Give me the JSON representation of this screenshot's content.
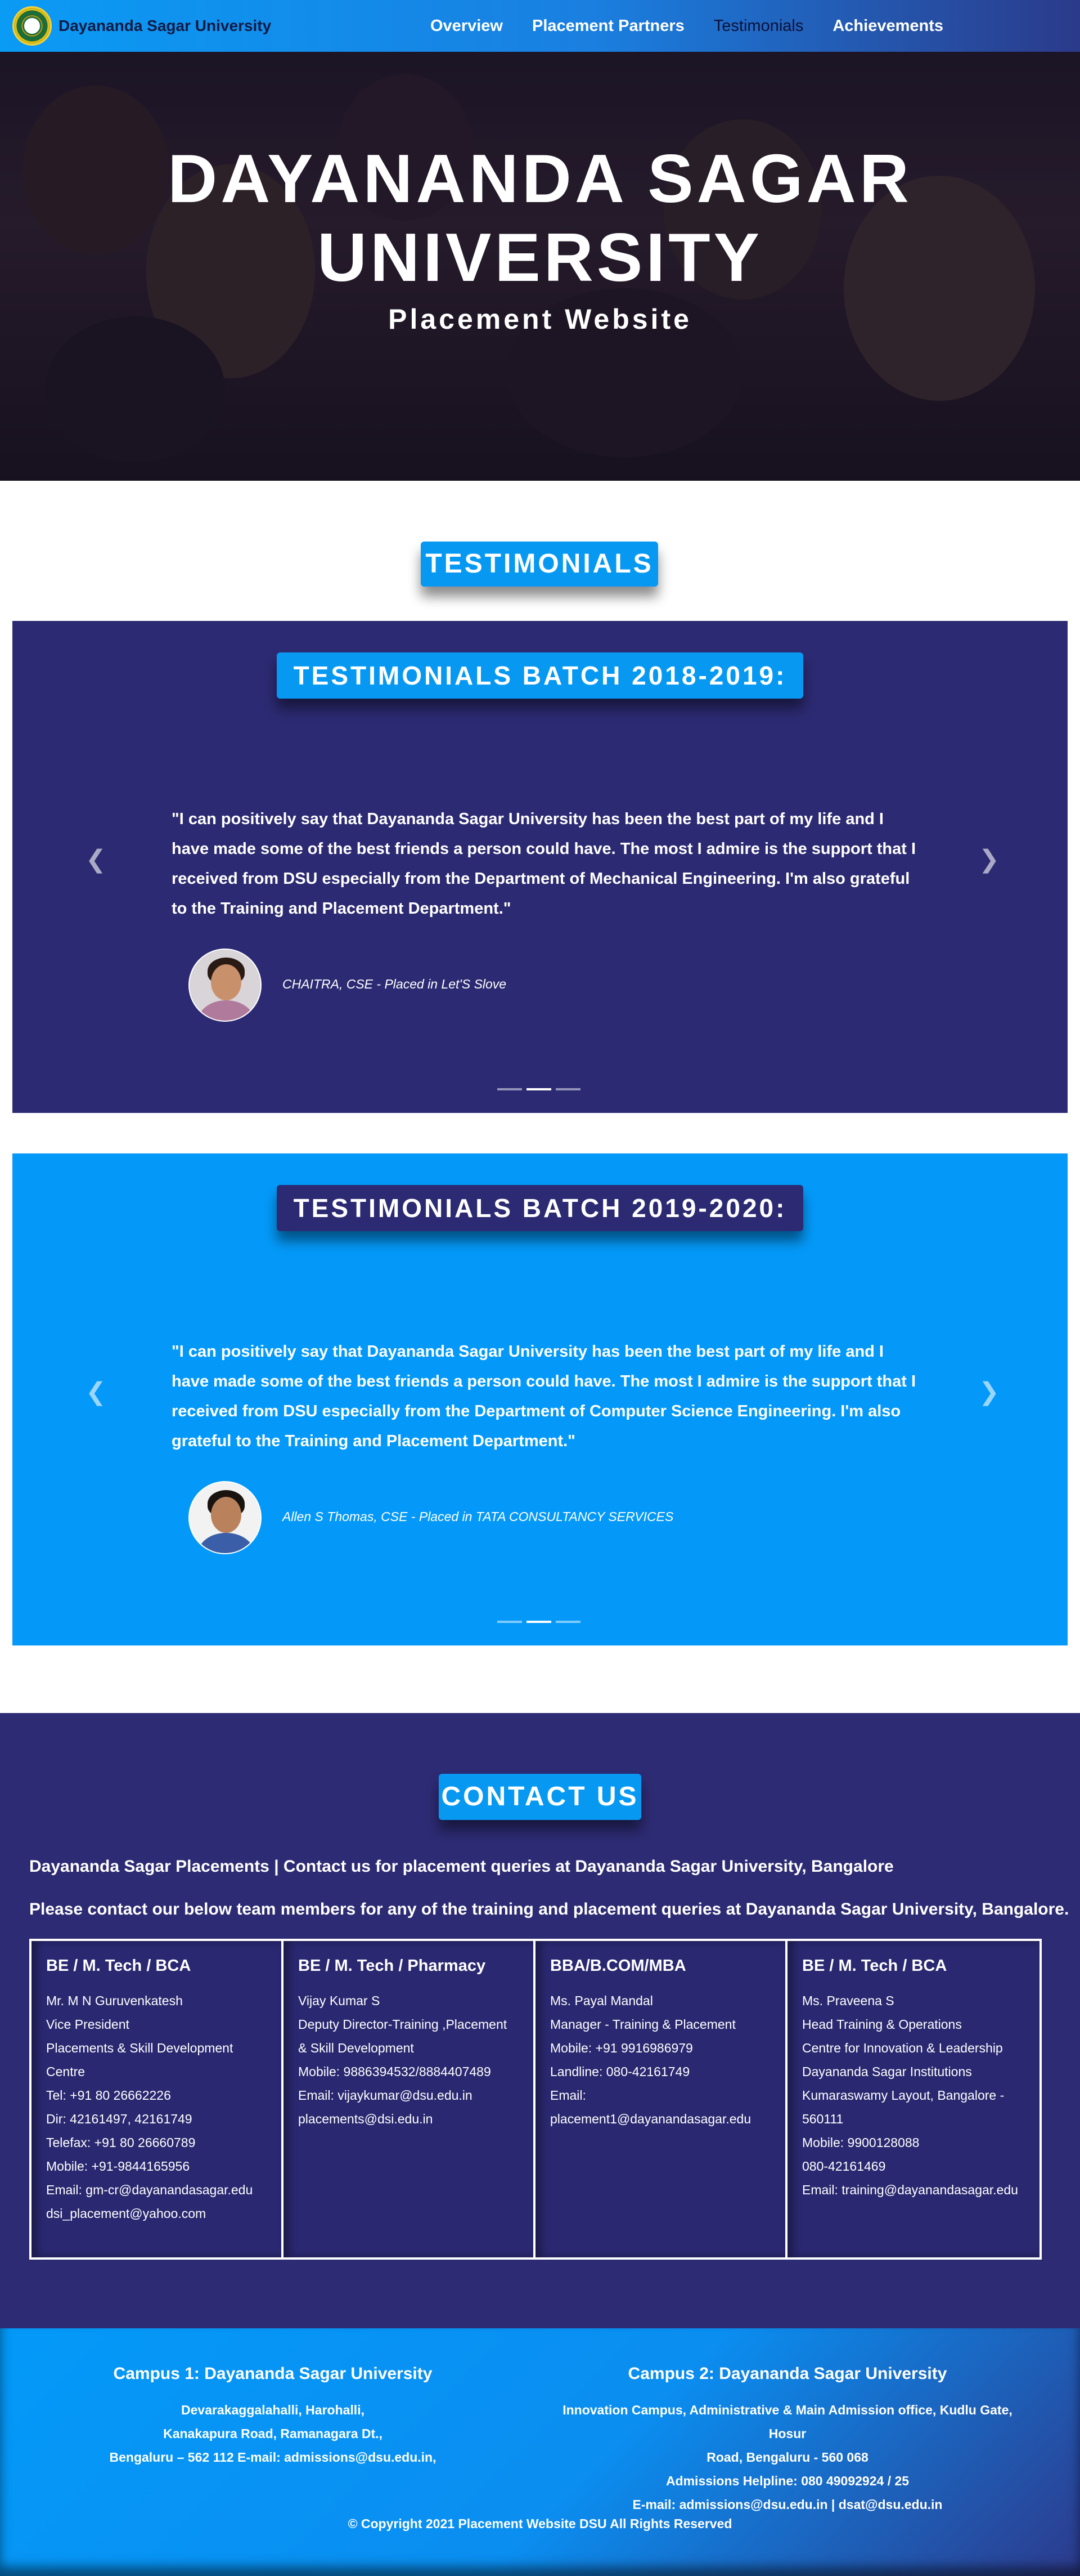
{
  "nav": {
    "brand": "Dayananda Sagar University",
    "links": [
      "Overview",
      "Placement Partners",
      "Testimonials",
      "Achievements"
    ]
  },
  "hero": {
    "title_line1": "DAYANANDA SAGAR",
    "title_line2": "UNIVERSITY",
    "subtitle": "Placement Website"
  },
  "testimonials": {
    "heading": "TESTIMONIALS",
    "batches": [
      {
        "heading": "TESTIMONIALS BATCH 2018-2019:",
        "quote": "\"I can positively say that Dayananda Sagar University has been the best part of my life and I have made some of the best friends a person could have. The most I admire is the support that I received from DSU especially from the Department of Mechanical Engineering. I'm also grateful to the Training and Placement Department.\"",
        "caption": "CHAITRA, CSE - Placed in Let'S Slove"
      },
      {
        "heading": "TESTIMONIALS BATCH 2019-2020:",
        "quote": "\"I can positively say that Dayananda Sagar University has been the best part of my life and I have made some of the best friends a person could have. The most I admire is the support that I received from DSU especially from the Department of Computer Science Engineering. I'm also grateful to the Training and Placement Department.\"",
        "caption": "Allen S Thomas, CSE - Placed in TATA CONSULTANCY SERVICES"
      }
    ],
    "prev_icon": "chevron-left-icon",
    "next_icon": "chevron-right-icon"
  },
  "contact": {
    "heading": "CONTACT US",
    "line1": "Dayananda Sagar Placements | Contact us for placement queries at Dayananda Sagar University, Bangalore",
    "line2": "Please contact our below team members for any of the training and placement queries at Dayananda Sagar University, Bangalore.",
    "cards": [
      {
        "title": "BE / M. Tech / BCA",
        "lines": [
          "Mr. M N Guruvenkatesh",
          "Vice President",
          "Placements & Skill Development",
          "Centre",
          "Tel: +91 80 26662226",
          "Dir: 42161497, 42161749",
          "Telefax: +91 80 26660789",
          "Mobile: +91-9844165956",
          "Email: gm-cr@dayanandasagar.edu",
          "dsi_placement@yahoo.com"
        ]
      },
      {
        "title": "BE / M. Tech / Pharmacy",
        "lines": [
          "Vijay Kumar S",
          "Deputy Director-Training ,Placement",
          "& Skill Development",
          "Mobile: 9886394532/8884407489",
          "Email: vijaykumar@dsu.edu.in",
          "placements@dsi.edu.in"
        ]
      },
      {
        "title": "BBA/B.COM/MBA",
        "lines": [
          "Ms. Payal Mandal",
          "Manager - Training & Placement",
          "Mobile: +91 9916986979",
          "Landline: 080-42161749",
          "Email:",
          "placement1@dayanandasagar.edu"
        ]
      },
      {
        "title": "BE / M. Tech / BCA",
        "lines": [
          "Ms. Praveena S",
          "Head Training & Operations",
          "Centre for Innovation & Leadership",
          "Dayananda Sagar Institutions",
          "Kumaraswamy Layout, Bangalore -",
          "560111",
          "Mobile: 9900128088",
          "080-42161469",
          "Email: training@dayanandasagar.edu"
        ]
      }
    ]
  },
  "footer": {
    "campus1": {
      "title": "Campus 1: Dayananda Sagar University",
      "lines": [
        "Devarakaggalahalli, Harohalli,",
        "Kanakapura Road, Ramanagara Dt.,",
        "Bengaluru – 562 112 E-mail: admissions@dsu.edu.in,"
      ]
    },
    "campus2": {
      "title": "Campus 2: Dayananda Sagar University",
      "lines": [
        "Innovation Campus, Administrative & Main Admission office, Kudlu Gate, Hosur",
        "Road, Bengaluru - 560 068",
        "Admissions Helpline: 080 49092924 / 25",
        "E-mail: admissions@dsu.edu.in | dsat@dsu.edu.in"
      ]
    },
    "copyright": "© Copyright 2021 Placement Website DSU All Rights Reserved"
  },
  "colors": {
    "primary_blue": "#0499f8",
    "navy": "#2c2a72",
    "nav_active_text": "#0d1136"
  }
}
